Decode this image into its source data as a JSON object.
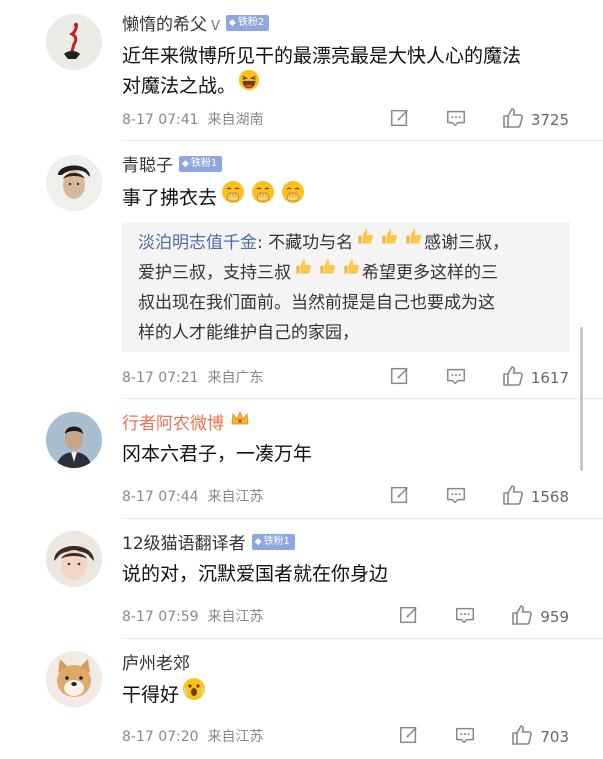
{
  "comments": [
    {
      "name": "懒惰的希父",
      "verify": "V",
      "badge": "铁粉2",
      "text": [
        "近年来微博所见干的最漂亮最是大快人心的魔法",
        "对魔法之战。"
      ],
      "time": "8-17 07:41",
      "location": "来自湖南",
      "likes": "3725"
    },
    {
      "name": "青聪子",
      "badge": "铁粉1",
      "text": [
        "事了拂衣去"
      ],
      "reply": {
        "name": "淡泊明志值千金",
        "lines": [
          ": 不藏功与名",
          "感谢三叔，",
          "爱护三叔，支持三叔",
          "希望更多这样的三",
          "叔出现在我们面前。当然前提是自己也要成为这",
          "样的人才能维护自己的家园，"
        ]
      },
      "time": "8-17 07:21",
      "location": "来自广东",
      "likes": "1617"
    },
    {
      "name": "行者阿农微博",
      "text": [
        "冈本六君子，一凑万年"
      ],
      "time": "8-17 07:44",
      "location": "来自江苏",
      "likes": "1568"
    },
    {
      "name": "12级猫语翻译者",
      "badge": "铁粉1",
      "text": [
        "说的对，沉默爱国者就在你身边"
      ],
      "time": "8-17 07:59",
      "location": "来自江苏",
      "likes": "959"
    },
    {
      "name": "庐州老郊",
      "text": [
        "干得好"
      ],
      "time": "8-17 07:20",
      "location": "来自江苏",
      "likes": "703"
    }
  ],
  "colors": {
    "accent": "#eb7350",
    "reply_name": "#4b6da8",
    "badge": "#8ea8de"
  },
  "icons": [
    "edit-icon",
    "comment-icon",
    "like-icon",
    "laugh-emoji",
    "thumbs-up-emoji",
    "crown-icon"
  ]
}
